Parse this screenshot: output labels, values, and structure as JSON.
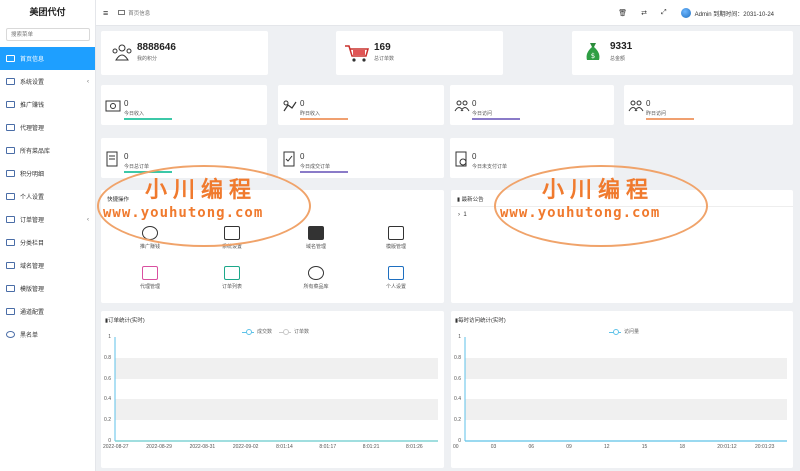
{
  "sidebar": {
    "brand": "美团代付",
    "search_placeholder": "搜索菜单",
    "items": [
      {
        "label": "首页信息",
        "arrow": ""
      },
      {
        "label": "系统设置",
        "arrow": "‹"
      },
      {
        "label": "推广赚钱",
        "arrow": ""
      },
      {
        "label": "代理管理",
        "arrow": ""
      },
      {
        "label": "所有菜品库",
        "arrow": ""
      },
      {
        "label": "积分明细",
        "arrow": ""
      },
      {
        "label": "个人设置",
        "arrow": ""
      },
      {
        "label": "订单管理",
        "arrow": "‹"
      },
      {
        "label": "分类栏目",
        "arrow": ""
      },
      {
        "label": "域名管理",
        "arrow": ""
      },
      {
        "label": "模版管理",
        "arrow": ""
      },
      {
        "label": "通道配置",
        "arrow": ""
      },
      {
        "label": "黑名单",
        "arrow": ""
      }
    ]
  },
  "topbar": {
    "hamburger": "≡",
    "breadcrumb": "首页信息",
    "user_info": "Admin 到期时间：2031-10-24"
  },
  "stats": [
    {
      "value": "8888646",
      "label": "我的积分"
    },
    {
      "value": "169",
      "label": "总订单数"
    },
    {
      "value": "9331",
      "label": "总金额"
    }
  ],
  "mini_stats": [
    {
      "value": "0",
      "label": "今日收入"
    },
    {
      "value": "0",
      "label": "昨日收入"
    },
    {
      "value": "0",
      "label": "今日访问"
    },
    {
      "value": "0",
      "label": "昨日访问"
    },
    {
      "value": "0",
      "label": "今日总订单"
    },
    {
      "value": "0",
      "label": "今日成交订单"
    },
    {
      "value": "0",
      "label": "今日未支付订单"
    }
  ],
  "quick": {
    "title": "快捷操作",
    "items": [
      "推广赚钱",
      "系统设置",
      "域名管理",
      "模版管理",
      "代理管理",
      "订单列表",
      "所有菜品库",
      "个人设置"
    ]
  },
  "notice": {
    "title": "最新公告",
    "item": "1"
  },
  "charts": [
    {
      "type": "line",
      "title": "订单统计(实时)",
      "series": [
        {
          "name": "成交数",
          "values": [
            0,
            0,
            0,
            0,
            0,
            0,
            0,
            0,
            0,
            0,
            0,
            0,
            0,
            0,
            0,
            0,
            0,
            0,
            0,
            0
          ]
        },
        {
          "name": "订单数",
          "values": [
            0,
            0,
            0,
            0,
            0,
            0,
            0,
            0,
            0,
            0,
            0,
            0,
            0,
            0,
            0,
            0,
            0,
            0,
            0,
            0
          ]
        }
      ],
      "x_ticks": [
        "2022-08-27",
        "2022-08-29",
        "2022-08-31",
        "2022-09-02",
        "8:01:14",
        "8:01:17",
        "8:01:21",
        "8:01:26"
      ],
      "y_ticks": [
        "1",
        "0.8",
        "0.6",
        "0.4",
        "0.2",
        "0"
      ],
      "ylim": [
        0,
        1
      ],
      "grid": "horizontal bands"
    },
    {
      "type": "line",
      "title": "每时访问统计(实时)",
      "series": [
        {
          "name": "访问量",
          "values": [
            0,
            0,
            0,
            0,
            0,
            0,
            0,
            0,
            0,
            0,
            0,
            0,
            0,
            0,
            0,
            0,
            0,
            0,
            0,
            0
          ]
        }
      ],
      "x_ticks": [
        "00",
        "03",
        "06",
        "09",
        "12",
        "15",
        "18",
        "20:01:12",
        "20:01:23"
      ],
      "y_ticks": [
        "1",
        "0.8",
        "0.6",
        "0.4",
        "0.2",
        "0"
      ],
      "ylim": [
        0,
        1
      ],
      "grid": "horizontal bands"
    }
  ],
  "watermark": {
    "cn": "小川编程",
    "url": "www.youhutong.com"
  },
  "colors": {
    "accent": "#1e9fff",
    "line": "#5ec2e8",
    "underline_green": "#3cc8a8",
    "underline_orange": "#f0a070",
    "underline_purple": "#8a7bc8",
    "watermark": "#f07a2e"
  }
}
